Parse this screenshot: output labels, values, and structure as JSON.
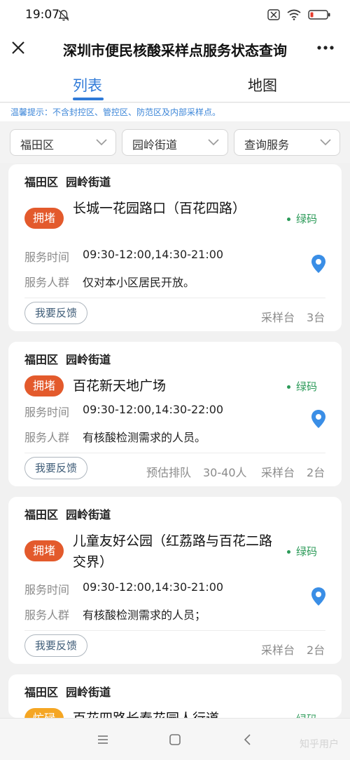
{
  "status_bar": {
    "time": "19:07"
  },
  "header": {
    "title": "深圳市便民核酸采样点服务状态查询"
  },
  "tabs": [
    {
      "label": "列表",
      "active": true
    },
    {
      "label": "地图",
      "active": false
    }
  ],
  "tip": "温馨提示：不含封控区、管控区、防范区及内部采样点。",
  "filters": {
    "district": "福田区",
    "street": "园岭街道",
    "service": "查询服务"
  },
  "labels": {
    "service_time": "服务时间",
    "service_group": "服务人群",
    "feedback": "我要反馈",
    "sampling_desk": "采样台",
    "estimated_queue": "预估排队"
  },
  "cards": [
    {
      "district": "福田区",
      "street": "园岭街道",
      "status": "拥堵",
      "name": "长城一花园路口（百花四路）",
      "code": "绿码",
      "time": "09:30-12:00,14:30-21:00",
      "group": "仅对本小区居民开放。",
      "desks": "3台"
    },
    {
      "district": "福田区",
      "street": "园岭街道",
      "status": "拥堵",
      "name": "百花新天地广场",
      "code": "绿码",
      "time": "09:30-12:00,14:30-22:00",
      "group": "有核酸检测需求的人员。",
      "queue": "30-40人",
      "desks": "2台"
    },
    {
      "district": "福田区",
      "street": "园岭街道",
      "status": "拥堵",
      "name": "儿童友好公园（红荔路与百花二路交界）",
      "code": "绿码",
      "time": "09:30-12:00,14:30-21:00",
      "group": "有核酸检测需求的人员；",
      "desks": "2台"
    },
    {
      "district": "福田区",
      "street": "园岭街道",
      "status": "忙碌",
      "name": "百花四路长春花园人行道",
      "code": "绿码"
    }
  ],
  "watermark": "知乎用户",
  "colors": {
    "accent": "#2f7ad8",
    "status_busy": "#e35a2c",
    "status_medium": "#f5a623",
    "green_code": "#2b9a58"
  }
}
